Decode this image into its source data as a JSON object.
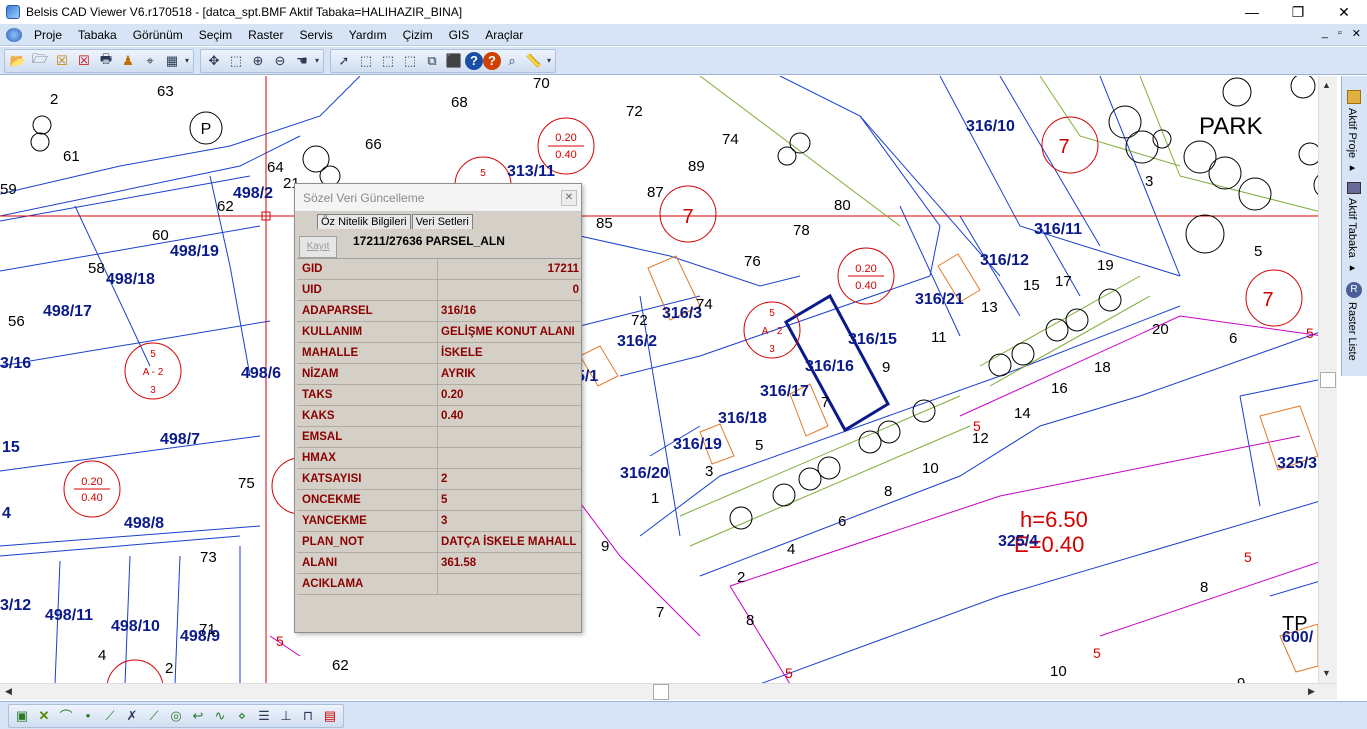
{
  "window": {
    "title": "Belsis CAD Viewer V6.r170518 - [datca_spt.BMF  Aktif Tabaka=HALIHAZIR_BINA]",
    "minimize": "—",
    "maximize": "❐",
    "close": "✕"
  },
  "menu": {
    "items": [
      "Proje",
      "Tabaka",
      "Görünüm",
      "Seçim",
      "Raster",
      "Servis",
      "Yardım",
      "Çizim",
      "GIS",
      "Araçlar"
    ],
    "mdi_min": "_",
    "mdi_restore": "▫",
    "mdi_close": "✕"
  },
  "side_panel": {
    "tabs": [
      "Aktif Proje ▸",
      "Aktif Tabaka ▸",
      "Raster Liste"
    ]
  },
  "map": {
    "labels_blue": [
      "498/2",
      "498/19",
      "498/18",
      "498/17",
      "3/16",
      "498/6",
      "498/7",
      "498/8",
      "498/11",
      "498/10",
      "498/9",
      "3/12",
      "15",
      "4",
      "313/11",
      "316/10",
      "316/11",
      "316/12",
      "316/21",
      "316/15",
      "316/16",
      "316/17",
      "316/18",
      "316/19",
      "316/20",
      "316/3",
      "316/2",
      "5/1",
      "325/4",
      "325/3",
      "600/"
    ],
    "labels_black": [
      "2",
      "63",
      "68",
      "70",
      "72",
      "74",
      "61",
      "66",
      "59",
      "62",
      "64",
      "21",
      "60",
      "58",
      "56",
      "89",
      "87",
      "85",
      "80",
      "78",
      "76",
      "74",
      "72",
      "75",
      "73",
      "71",
      "62",
      "4",
      "2",
      "3",
      "5",
      "17",
      "15",
      "19",
      "13",
      "11",
      "9",
      "7",
      "5",
      "3",
      "1",
      "20",
      "6",
      "16",
      "18",
      "14",
      "12",
      "10",
      "8",
      "6",
      "4",
      "2",
      "8",
      "7",
      "9",
      "10",
      "8",
      "9"
    ],
    "labels_red": [
      "7",
      "7",
      "7",
      "5",
      "5",
      "5",
      "5",
      "5",
      "5"
    ],
    "park": "PARK",
    "p_symbol": "P",
    "h_text": "h=6.50",
    "e_text": "E=0.40",
    "tp_text": "TP",
    "zone_ratios": [
      "0.20",
      "0.40"
    ],
    "zone_codes": [
      "5",
      "A - 2",
      "3"
    ]
  },
  "dialog": {
    "title": "Sözel Veri Güncelleme",
    "close": "✕",
    "tabs": [
      "Öz Nitelik Bilgileri",
      "Veri Setleri"
    ],
    "save_button": "Kayıt",
    "record_title": "17211/27636 PARSEL_ALN",
    "rows": [
      {
        "key": "GID",
        "value": "17211"
      },
      {
        "key": "UID",
        "value": "0"
      },
      {
        "key": "ADAPARSEL",
        "value": "316/16"
      },
      {
        "key": "KULLANIM",
        "value": "GELİŞME KONUT ALANI"
      },
      {
        "key": "MAHALLE",
        "value": "İSKELE"
      },
      {
        "key": "NİZAM",
        "value": "AYRIK"
      },
      {
        "key": "TAKS",
        "value": "0.20"
      },
      {
        "key": "KAKS",
        "value": "0.40"
      },
      {
        "key": "EMSAL",
        "value": ""
      },
      {
        "key": "HMAX",
        "value": ""
      },
      {
        "key": "KATSAYISI",
        "value": "2"
      },
      {
        "key": "ONCEKME",
        "value": "5"
      },
      {
        "key": "YANCEKME",
        "value": "3"
      },
      {
        "key": "PLAN_NOT",
        "value": "DATÇA İSKELE MAHALL"
      },
      {
        "key": "ALANI",
        "value": "361.58"
      },
      {
        "key": "ACIKLAMA",
        "value": ""
      }
    ]
  },
  "colors": {
    "parcel_blue": "#0a1a8a",
    "zone_red": "#d40000",
    "boundary_magenta": "#c800c8",
    "road_green": "#7fae3a",
    "building_orange": "#e07a2a",
    "field_text": "#8b0000",
    "chrome": "#d7e4f5"
  }
}
